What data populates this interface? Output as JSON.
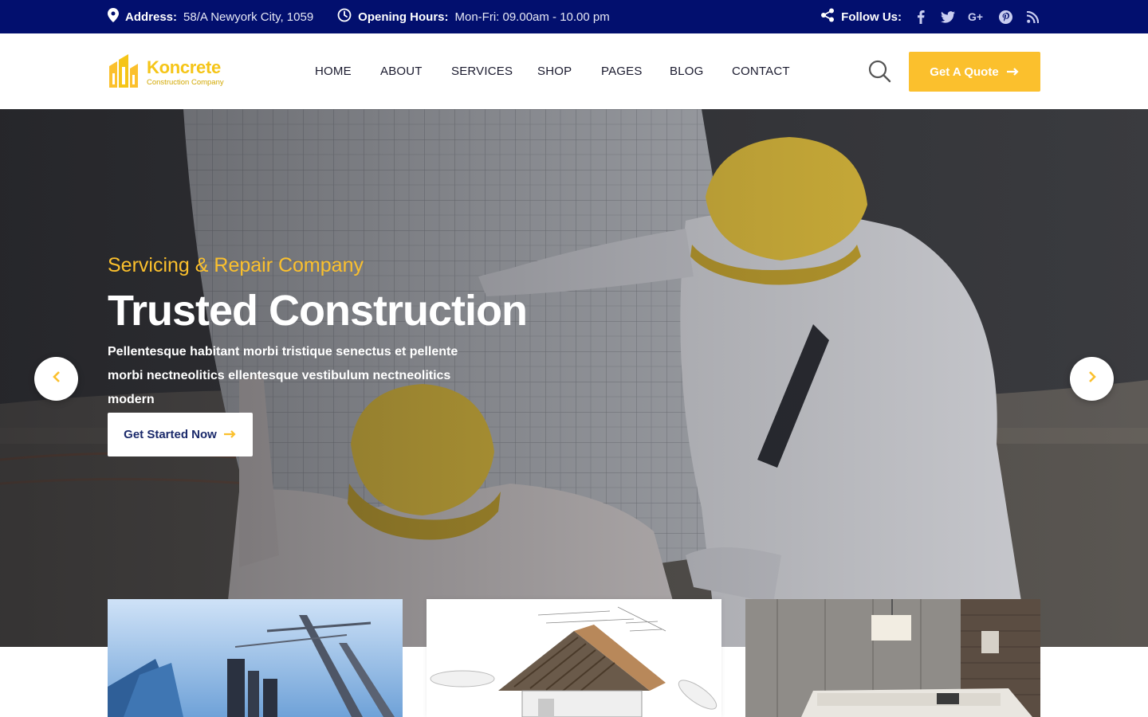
{
  "topbar": {
    "address_label": "Address:",
    "address_value": "58/A Newyork City, 1059",
    "hours_label": "Opening Hours:",
    "hours_value": "Mon-Fri: 09.00am - 10.00 pm",
    "follow_label": "Follow Us:",
    "social": [
      "facebook-icon",
      "twitter-icon",
      "google-plus-icon",
      "pinterest-icon",
      "rss-icon"
    ]
  },
  "logo": {
    "name": "Koncrete",
    "tagline": "Construction Company"
  },
  "nav": {
    "items": [
      "HOME",
      "ABOUT",
      "SERVICES",
      "SHOP",
      "PAGES",
      "BLOG",
      "CONTACT"
    ]
  },
  "header": {
    "quote_label": "Get A Quote"
  },
  "hero": {
    "subtitle": "Servicing & Repair Company",
    "title": "Trusted Construction",
    "description": "Pellentesque habitant morbi tristique senectus et pellente morbi nectneolitics ellentesque vestibulum nectneolitics modern",
    "cta_label": "Get Started Now"
  },
  "colors": {
    "topbar_bg": "#020f6e",
    "accent": "#fbc02d",
    "nav_text": "#1a1a2e",
    "cta_text": "#1b2a6b"
  }
}
